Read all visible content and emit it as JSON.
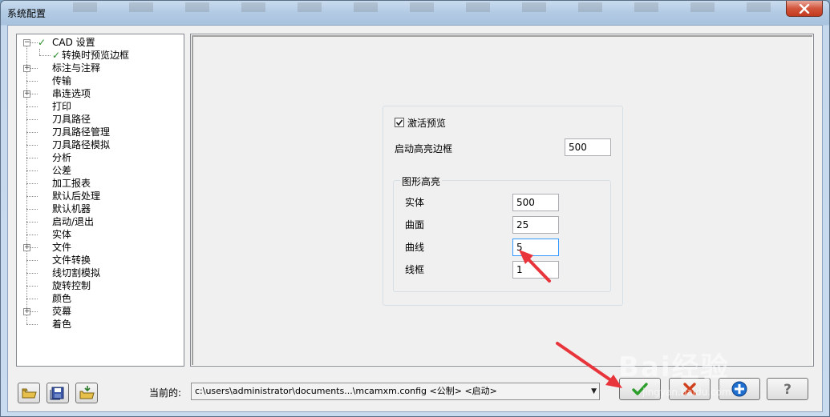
{
  "window": {
    "title": "系统配置"
  },
  "tree": {
    "items": [
      {
        "label": "CAD 设置",
        "expander": "minus",
        "checked": true
      },
      {
        "label": "转换时预览边框",
        "child": true,
        "checked": true
      },
      {
        "label": "标注与注释",
        "expander": "plus"
      },
      {
        "label": "传输"
      },
      {
        "label": "串连选项",
        "expander": "plus"
      },
      {
        "label": "打印"
      },
      {
        "label": "刀具路径"
      },
      {
        "label": "刀具路径管理"
      },
      {
        "label": "刀具路径模拟"
      },
      {
        "label": "分析"
      },
      {
        "label": "公差"
      },
      {
        "label": "加工报表"
      },
      {
        "label": "默认后处理"
      },
      {
        "label": "默认机器"
      },
      {
        "label": "启动/退出"
      },
      {
        "label": "实体"
      },
      {
        "label": "文件",
        "expander": "plus"
      },
      {
        "label": "文件转换"
      },
      {
        "label": "线切割模拟"
      },
      {
        "label": "旋转控制"
      },
      {
        "label": "颜色"
      },
      {
        "label": "荧幕",
        "expander": "plus"
      },
      {
        "label": "着色"
      }
    ]
  },
  "preview": {
    "activate_label": "激活预览",
    "activate_checked": true,
    "start_highlight_label": "启动高亮边框",
    "start_highlight_value": "500",
    "group_label": "图形高亮",
    "fields": [
      {
        "label": "实体",
        "value": "500"
      },
      {
        "label": "曲面",
        "value": "25"
      },
      {
        "label": "曲线",
        "value": "5"
      },
      {
        "label": "线框",
        "value": "1"
      }
    ]
  },
  "footer": {
    "current_label": "当前的:",
    "config_path": "c:\\users\\administrator\\documents...\\mcamxm.config <公制> <启动>",
    "toolbar_icons": [
      "open-folder-icon",
      "save-icon",
      "merge-folder-icon"
    ],
    "actions": [
      "ok-check-icon",
      "cancel-x-icon",
      "apply-plus-icon",
      "help-question-icon"
    ]
  },
  "watermark": {
    "text": "Bai经验",
    "sub": "jingyan.baidu.com"
  },
  "colors": {
    "annotation_arrow": "#e8353b",
    "ok_green": "#2a9d2a",
    "cancel_red": "#d0401c",
    "apply_blue": "#1e6fd0"
  }
}
